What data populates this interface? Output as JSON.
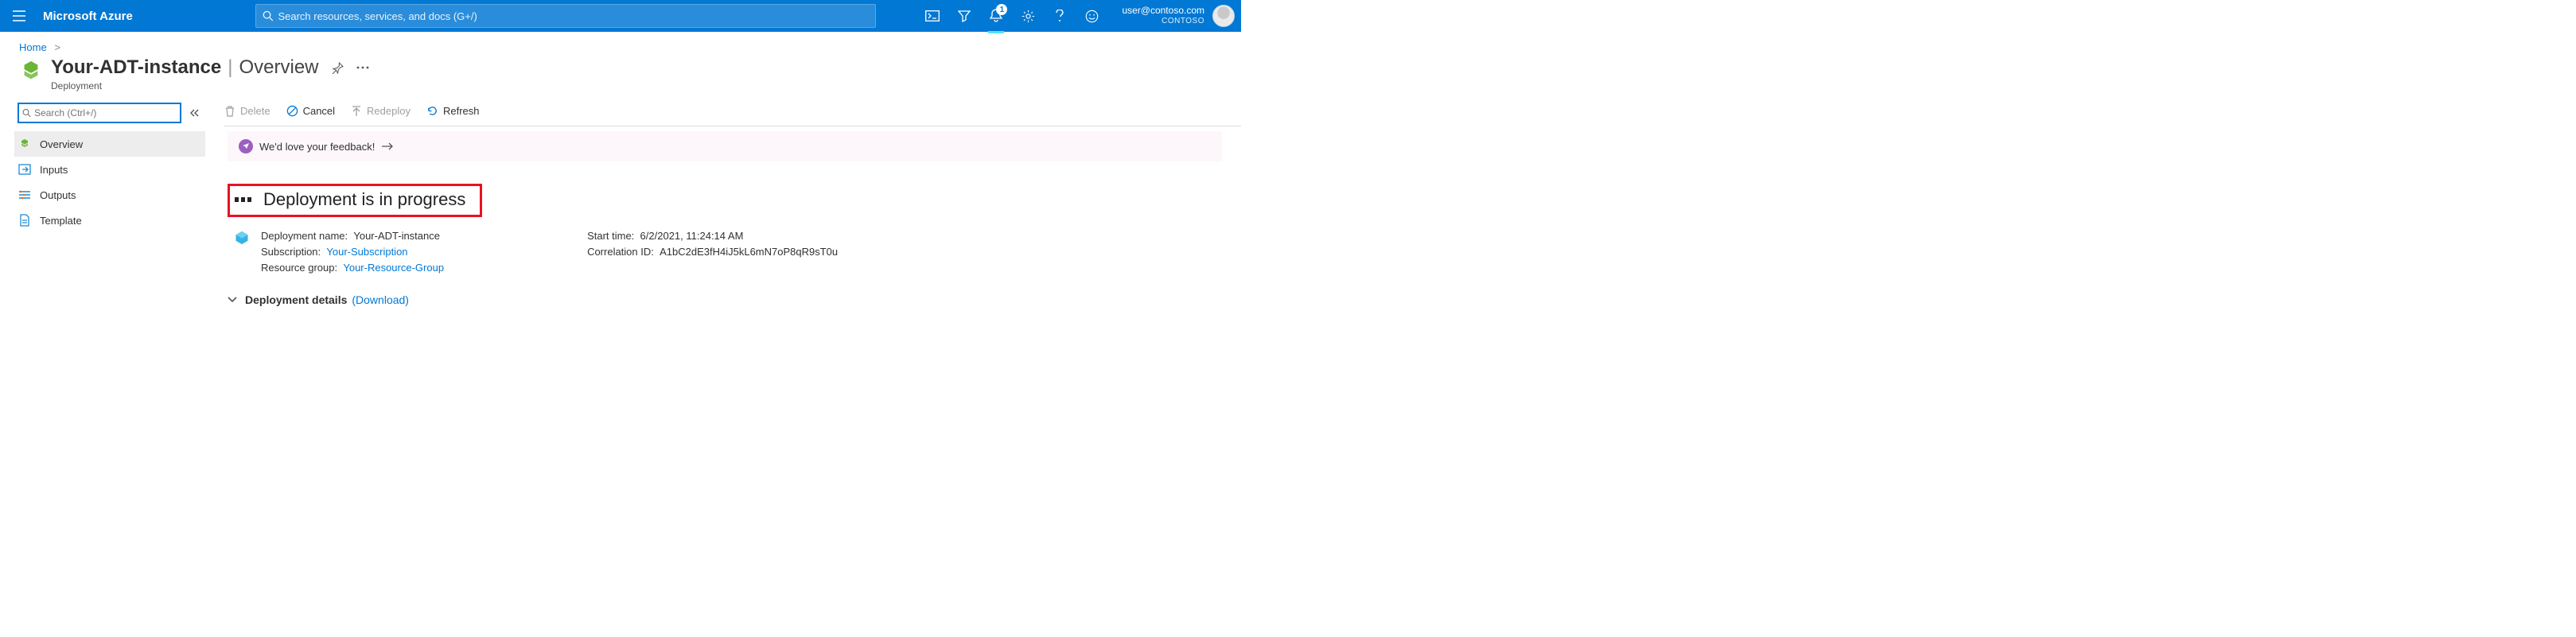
{
  "topbar": {
    "brand": "Microsoft Azure",
    "search_placeholder": "Search resources, services, and docs (G+/)",
    "notification_count": "1",
    "user_email": "user@contoso.com",
    "directory": "CONTOSO"
  },
  "breadcrumb": {
    "home": "Home"
  },
  "header": {
    "title": "Your-ADT-instance",
    "tab": "Overview",
    "subtitle": "Deployment"
  },
  "sidebar": {
    "search_placeholder": "Search (Ctrl+/)",
    "items": [
      {
        "label": "Overview"
      },
      {
        "label": "Inputs"
      },
      {
        "label": "Outputs"
      },
      {
        "label": "Template"
      }
    ]
  },
  "toolbar": {
    "delete": "Delete",
    "cancel": "Cancel",
    "redeploy": "Redeploy",
    "refresh": "Refresh"
  },
  "feedback": {
    "text": "We'd love your feedback!"
  },
  "status": {
    "title": "Deployment is in progress"
  },
  "details": {
    "deployment_name_label": "Deployment name:",
    "deployment_name": "Your-ADT-instance",
    "subscription_label": "Subscription:",
    "subscription": "Your-Subscription",
    "resource_group_label": "Resource group:",
    "resource_group": "Your-Resource-Group",
    "start_time_label": "Start time:",
    "start_time": "6/2/2021, 11:24:14 AM",
    "correlation_label": "Correlation ID:",
    "correlation": "A1bC2dE3fH4iJ5kL6mN7oP8qR9sT0u"
  },
  "expander": {
    "label": "Deployment details",
    "link": "(Download)"
  }
}
